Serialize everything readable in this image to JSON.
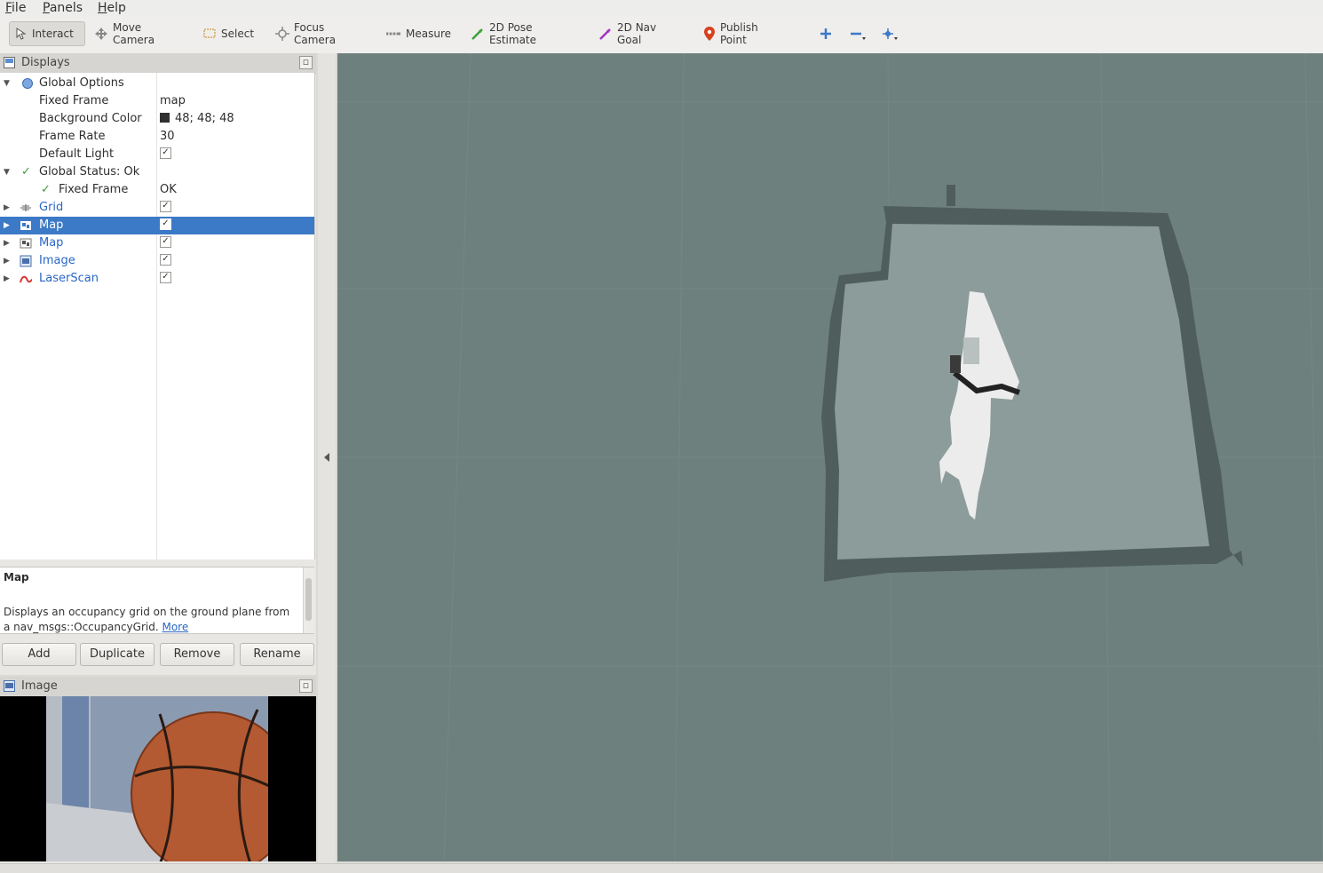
{
  "menu": [
    "File",
    "Panels",
    "Help"
  ],
  "toolbar": {
    "tools": [
      {
        "label": "Interact",
        "icon": "interact-icon",
        "active": true
      },
      {
        "label": "Move Camera",
        "icon": "move-camera-icon"
      },
      {
        "label": "Select",
        "icon": "select-icon"
      },
      {
        "label": "Focus Camera",
        "icon": "focus-camera-icon"
      },
      {
        "label": "Measure",
        "icon": "measure-icon"
      },
      {
        "label": "2D Pose Estimate",
        "icon": "pose-estimate-icon"
      },
      {
        "label": "2D Nav Goal",
        "icon": "nav-goal-icon"
      },
      {
        "label": "Publish Point",
        "icon": "publish-point-icon"
      }
    ],
    "extra_icons": [
      "add-tool-icon",
      "remove-tool-icon",
      "tool-properties-icon"
    ]
  },
  "displays_panel": {
    "title": "Displays",
    "tree": {
      "global_options": {
        "label": "Global Options",
        "fixed_frame_label": "Fixed Frame",
        "fixed_frame_value": "map",
        "background_color_label": "Background Color",
        "background_color_value": "48; 48; 48",
        "background_color_hex": "#303030",
        "frame_rate_label": "Frame Rate",
        "frame_rate_value": "30",
        "default_light_label": "Default Light",
        "default_light_checked": true
      },
      "global_status": {
        "label": "Global Status: Ok",
        "fixed_frame_label": "Fixed Frame",
        "fixed_frame_value": "OK"
      },
      "displays": [
        {
          "name": "Grid",
          "icon": "grid-icon",
          "enabled": true,
          "selected": false
        },
        {
          "name": "Map",
          "icon": "map-icon",
          "enabled": true,
          "selected": true
        },
        {
          "name": "Map",
          "icon": "map-icon",
          "enabled": true,
          "selected": false
        },
        {
          "name": "Image",
          "icon": "image-icon",
          "enabled": true,
          "selected": false
        },
        {
          "name": "LaserScan",
          "icon": "laserscan-icon",
          "enabled": true,
          "selected": false
        }
      ]
    },
    "description": {
      "title": "Map",
      "text": "Displays an occupancy grid on the ground plane from a nav_msgs::OccupancyGrid.",
      "more_link": "More"
    },
    "buttons": {
      "add": "Add",
      "duplicate": "Duplicate",
      "remove": "Remove",
      "rename": "Rename"
    }
  },
  "image_panel": {
    "title": "Image"
  },
  "colors": {
    "viewport_bg": "#6e807e",
    "selection": "#3c79c6",
    "link": "#2a66c4"
  }
}
